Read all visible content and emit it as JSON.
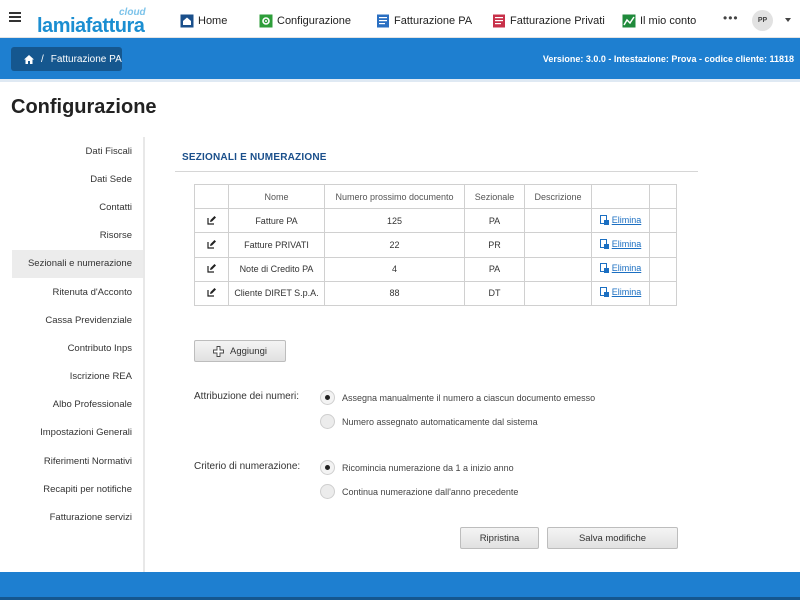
{
  "brand": {
    "name_part1": "la",
    "name_part2": "miafattura",
    "cloud": "cloud"
  },
  "nav": [
    {
      "label": "Home",
      "icon": "home-icon"
    },
    {
      "label": "Configurazione",
      "icon": "settings-icon"
    },
    {
      "label": "Fatturazione PA",
      "icon": "invoice-pa-icon"
    },
    {
      "label": "Fatturazione Privati",
      "icon": "invoice-private-icon"
    },
    {
      "label": "Il mio conto",
      "icon": "account-chart-icon"
    }
  ],
  "more": "•••",
  "user": {
    "initials": "PP"
  },
  "breadcrumb": {
    "label": "Fatturazione PA",
    "sep": "/"
  },
  "version_info": "Versione: 3.0.0 - Intestazione: Prova - codice cliente: 11818",
  "page_title": "Configurazione",
  "sidebar": [
    {
      "label": "Dati Fiscali"
    },
    {
      "label": "Dati Sede"
    },
    {
      "label": "Contatti"
    },
    {
      "label": "Risorse"
    },
    {
      "label": "Sezionali e numerazione",
      "active": true
    },
    {
      "label": "Ritenuta d'Acconto"
    },
    {
      "label": "Cassa Previdenziale"
    },
    {
      "label": "Contributo Inps"
    },
    {
      "label": "Iscrizione REA"
    },
    {
      "label": "Albo Professionale"
    },
    {
      "label": "Impostazioni Generali"
    },
    {
      "label": "Riferimenti Normativi"
    },
    {
      "label": "Recapiti per notifiche"
    },
    {
      "label": "Fatturazione servizi"
    }
  ],
  "section_title": "SEZIONALI E NUMERAZIONE",
  "table": {
    "headers": [
      "",
      "Nome",
      "Numero prossimo documento",
      "Sezionale",
      "Descrizione",
      "",
      ""
    ],
    "delete_label": "Elimina",
    "rows": [
      {
        "nome": "Fatture PA",
        "numero": "125",
        "sezionale": "PA",
        "descrizione": ""
      },
      {
        "nome": "Fatture PRIVATI",
        "numero": "22",
        "sezionale": "PR",
        "descrizione": ""
      },
      {
        "nome": "Note di Credito PA",
        "numero": "4",
        "sezionale": "PA",
        "descrizione": ""
      },
      {
        "nome": "Cliente DIRET S.p.A.",
        "numero": "88",
        "sezionale": "DT",
        "descrizione": ""
      }
    ]
  },
  "add_button": "Aggiungi",
  "attribuzione": {
    "label": "Attribuzione dei numeri:",
    "options": [
      {
        "label": "Assegna manualmente il numero a ciascun documento emesso",
        "selected": true
      },
      {
        "label": "Numero assegnato automaticamente dal sistema",
        "selected": false
      }
    ]
  },
  "criterio": {
    "label": "Criterio di numerazione:",
    "options": [
      {
        "label": "Ricomincia numerazione da 1 a inizio anno",
        "selected": true
      },
      {
        "label": "Continua numerazione dall'anno precedente",
        "selected": false
      }
    ]
  },
  "buttons": {
    "reset": "Ripristina",
    "save": "Salva modifiche"
  },
  "colors": {
    "primary": "#1e7fd0",
    "crumb": "#15578f",
    "section_title": "#1a4f8b",
    "link": "#1b6fc2"
  }
}
